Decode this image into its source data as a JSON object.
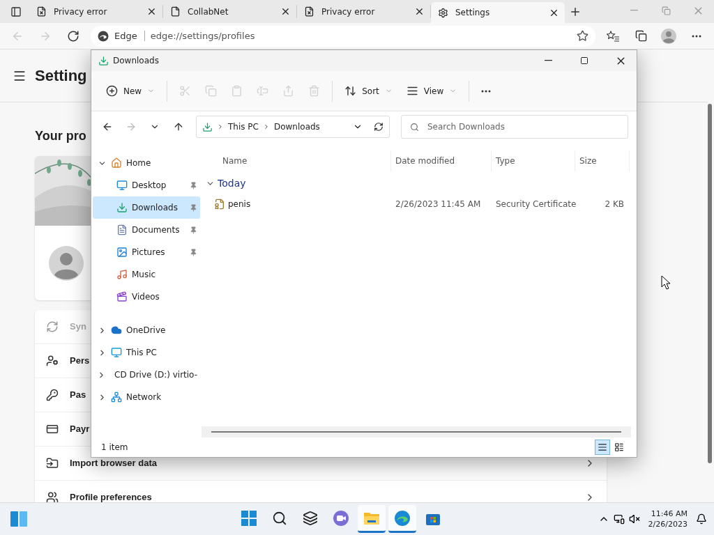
{
  "browser": {
    "tabs": [
      {
        "title": "Privacy error",
        "kind": "error",
        "selected": false
      },
      {
        "title": "CollabNet",
        "kind": "page",
        "selected": false
      },
      {
        "title": "Privacy error",
        "kind": "error",
        "selected": false
      },
      {
        "title": "Settings",
        "kind": "settings",
        "selected": true
      }
    ],
    "brand": "Edge",
    "url": "edge://settings/profiles"
  },
  "settings": {
    "title": "Setting",
    "section": "Your pro",
    "rows": [
      {
        "label": "Syn",
        "kind": "sync",
        "disabled": true
      },
      {
        "label": "Pers",
        "kind": "personal",
        "disabled": false
      },
      {
        "label": "Pas",
        "kind": "password",
        "disabled": false
      },
      {
        "label": "Payr",
        "kind": "payment",
        "disabled": false
      },
      {
        "label": "Import browser data",
        "kind": "import",
        "disabled": false
      },
      {
        "label": "Profile preferences",
        "kind": "preferences",
        "disabled": false
      }
    ]
  },
  "explorer": {
    "title": "Downloads",
    "toolbar": [
      {
        "kind": "new",
        "label": "New",
        "disabled": false
      },
      {
        "kind": "cut",
        "disabled": true
      },
      {
        "kind": "copy",
        "disabled": true
      },
      {
        "kind": "paste",
        "disabled": true
      },
      {
        "kind": "rename",
        "disabled": true
      },
      {
        "kind": "share",
        "disabled": true
      },
      {
        "kind": "delete",
        "disabled": true
      },
      {
        "kind": "sort",
        "label": "Sort",
        "disabled": false
      },
      {
        "kind": "view",
        "label": "View",
        "disabled": false
      },
      {
        "kind": "more",
        "disabled": false
      }
    ],
    "breadcrumbs": [
      "This PC",
      "Downloads"
    ],
    "search": {
      "placeholder": "Search Downloads"
    },
    "nav": [
      {
        "label": "Home",
        "kind": "home",
        "expanded": true,
        "children": [
          {
            "label": "Desktop",
            "kind": "desktop",
            "pinned": true,
            "selected": false
          },
          {
            "label": "Downloads",
            "kind": "downloads",
            "pinned": true,
            "selected": true
          },
          {
            "label": "Documents",
            "kind": "documents",
            "pinned": true,
            "selected": false
          },
          {
            "label": "Pictures",
            "kind": "pictures",
            "pinned": true,
            "selected": false
          },
          {
            "label": "Music",
            "kind": "music",
            "pinned": false,
            "selected": false
          },
          {
            "label": "Videos",
            "kind": "videos",
            "pinned": false,
            "selected": false
          }
        ]
      },
      {
        "label": "OneDrive",
        "kind": "onedrive",
        "expanded": false
      },
      {
        "label": "This PC",
        "kind": "pc",
        "expanded": false
      },
      {
        "label": "CD Drive (D:) virtio-",
        "kind": "cd",
        "expanded": false
      },
      {
        "label": "Network",
        "kind": "network",
        "expanded": false
      }
    ],
    "columns": [
      "Name",
      "Date modified",
      "Type",
      "Size"
    ],
    "group": "Today",
    "files": [
      {
        "name": "penis",
        "date": "2/26/2023 11:45 AM",
        "type": "Security Certificate",
        "size": "2 KB"
      }
    ],
    "status": "1 item",
    "views": [
      {
        "kind": "details",
        "selected": true
      },
      {
        "kind": "tiles",
        "selected": false
      }
    ]
  },
  "taskbar": {
    "apps": [
      {
        "kind": "start",
        "open": false
      },
      {
        "kind": "search",
        "open": false
      },
      {
        "kind": "taskview",
        "open": false
      },
      {
        "kind": "chat",
        "open": false
      },
      {
        "kind": "explorer",
        "open": true
      },
      {
        "kind": "edge",
        "open": true
      },
      {
        "kind": "store",
        "open": false
      }
    ],
    "time": "11:46 AM",
    "date": "2/26/2023"
  }
}
